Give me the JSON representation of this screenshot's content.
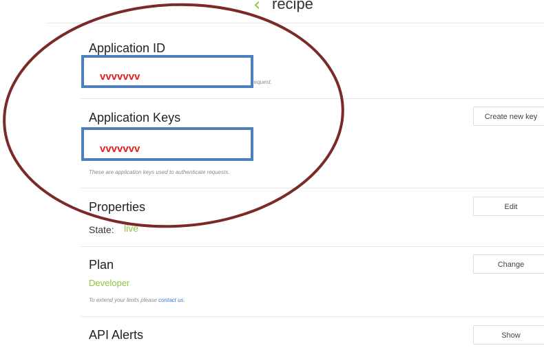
{
  "header": {
    "back_icon": "chevron-left-icon",
    "title": "recipe"
  },
  "app_id": {
    "title": "Application ID",
    "redacted_value": "vvvvvvv",
    "hint_tail": "request."
  },
  "app_keys": {
    "title": "Application Keys",
    "redacted_value": "vvvvvvv",
    "hint": "These are application keys used to authenticate requests.",
    "button": "Create new key"
  },
  "properties": {
    "title": "Properties",
    "button": "Edit",
    "state_label": "State:",
    "state_value": "live"
  },
  "plan": {
    "title": "Plan",
    "button": "Change",
    "value": "Developer",
    "hint_prefix": "To extend your limits please ",
    "hint_link": "contact us",
    "hint_suffix": "."
  },
  "api_alerts": {
    "title": "API Alerts",
    "button": "Show"
  },
  "colors": {
    "accent": "#8cc63f",
    "annotation_oval": "#7b2a2a",
    "redaction_box": "#4e7fbd",
    "redaction_text": "#e0201c"
  }
}
